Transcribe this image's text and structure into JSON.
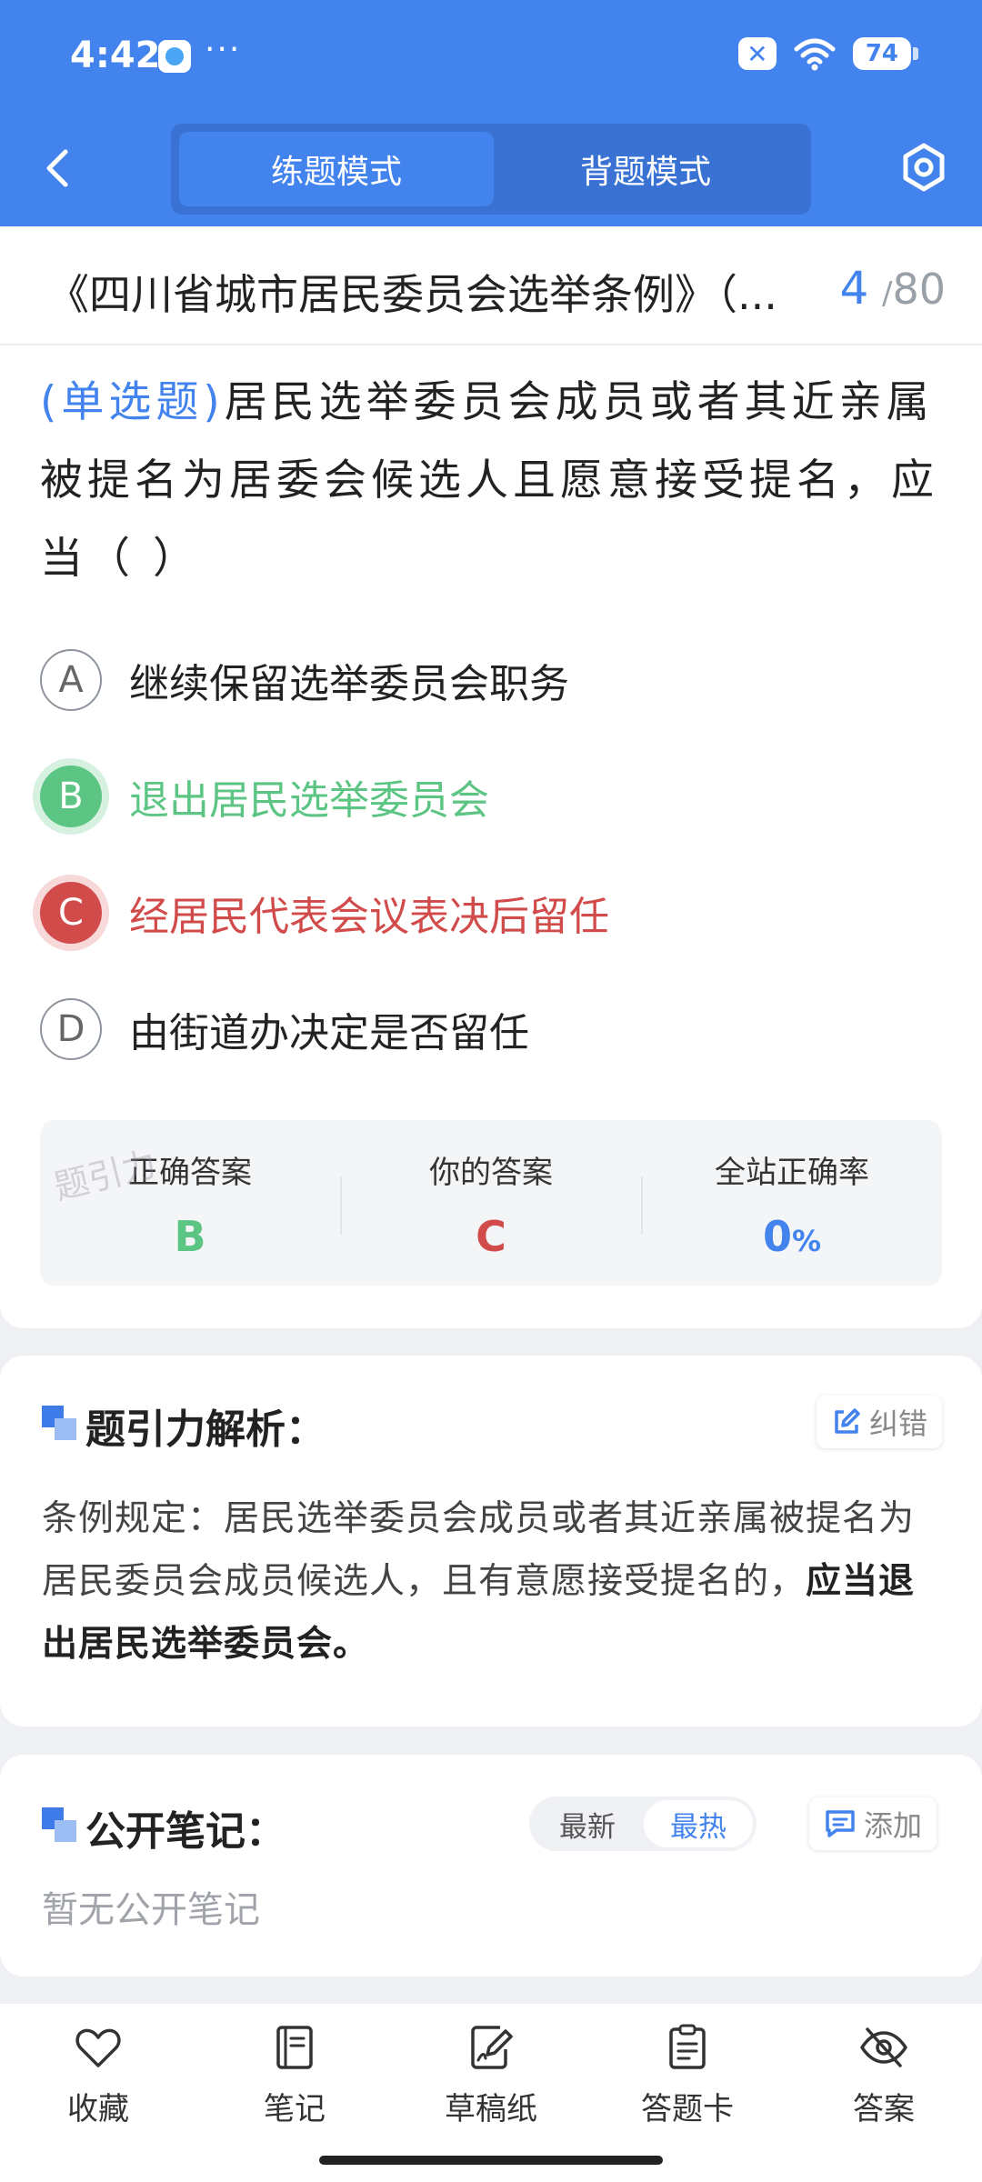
{
  "status_bar": {
    "time": "4:42",
    "more": "···",
    "battery": "74"
  },
  "header": {
    "mode_tabs": [
      {
        "label": "练题模式",
        "active": true
      },
      {
        "label": "背题模式",
        "active": false
      }
    ]
  },
  "question_header": {
    "doc_title": "《四川省城市居民委员会选举条例》（...",
    "current": "4",
    "separator": "/",
    "total": "80"
  },
  "question": {
    "type_label": "(单选题)",
    "text": "居民选举委员会成员或者其近亲属被提名为居委会候选人且愿意接受提名，应当（    ）",
    "options": [
      {
        "letter": "A",
        "text": "继续保留选举委员会职务",
        "state": "default"
      },
      {
        "letter": "B",
        "text": "退出居民选举委员会",
        "state": "correct"
      },
      {
        "letter": "C",
        "text": "经居民代表会议表决后留任",
        "state": "wrong"
      },
      {
        "letter": "D",
        "text": "由街道办决定是否留任",
        "state": "default"
      }
    ]
  },
  "result": {
    "correct_label": "正确答案",
    "correct_value": "B",
    "yours_label": "你的答案",
    "yours_value": "C",
    "rate_label": "全站正确率",
    "rate_value": "0",
    "rate_unit": "%"
  },
  "watermark": "题引力",
  "analysis": {
    "title": "题引力解析：",
    "report_label": "纠错",
    "text_main": "条例规定：居民选举委员会成员或者其近亲属被提名为居民委员会成员候选人，且有意愿接受提名的，",
    "text_em": "应当退出居民选举委员会。"
  },
  "notes": {
    "title": "公开笔记：",
    "sort_tabs": [
      "最新",
      "最热"
    ],
    "add_label": "添加",
    "empty_text": "暂无公开笔记"
  },
  "bottom_nav": {
    "collect": "收藏",
    "notes": "笔记",
    "draft": "草稿纸",
    "answer_card": "答题卡",
    "answer": "答案"
  },
  "colors": {
    "primary": "#4383ee",
    "correct": "#5cc584",
    "wrong": "#d24b4b"
  }
}
